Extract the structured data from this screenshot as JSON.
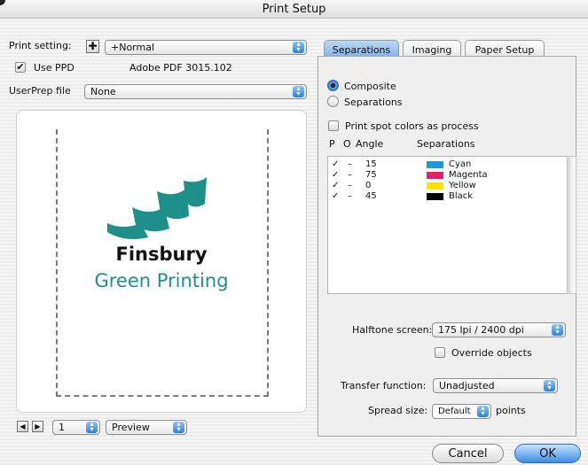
{
  "window": {
    "title": "Print Setup"
  },
  "left": {
    "print_setting_label": "Print setting:",
    "print_setting_value": "+Normal",
    "use_ppd_label": "Use PPD",
    "ppd_name": "Adobe PDF 3015.102",
    "userprep_label": "UserPrep file",
    "userprep_value": "None",
    "logo_line1": "Finsbury",
    "logo_line2": "Green Printing",
    "page_number": "1",
    "view_mode": "Preview"
  },
  "tabs": [
    {
      "label": "Separations"
    },
    {
      "label": "Imaging"
    },
    {
      "label": "Paper Setup"
    }
  ],
  "separations": {
    "composite_label": "Composite",
    "separations_label": "Separations",
    "spot_colors_label": "Print spot colors as process",
    "col_p": "P",
    "col_o": "O",
    "col_angle": "Angle",
    "col_separations": "Separations",
    "rows": [
      {
        "check": "✓",
        "dash": "–",
        "angle": "15",
        "name": "Cyan",
        "color": "#1a9ad6"
      },
      {
        "check": "✓",
        "dash": "–",
        "angle": "75",
        "name": "Magenta",
        "color": "#e4206a"
      },
      {
        "check": "✓",
        "dash": "–",
        "angle": "0",
        "name": "Yellow",
        "color": "#ffe600"
      },
      {
        "check": "✓",
        "dash": "–",
        "angle": "45",
        "name": "Black",
        "color": "#000000"
      }
    ],
    "halftone_label": "Halftone screen:",
    "halftone_value": "175 lpi / 2400 dpi",
    "override_label": "Override objects",
    "transfer_label": "Transfer function:",
    "transfer_value": "Unadjusted",
    "spread_label": "Spread size:",
    "spread_value": "Default",
    "spread_unit": "points"
  },
  "buttons": {
    "cancel": "Cancel",
    "ok": "OK"
  },
  "colors": {
    "logo_teal": "#1f8f8a",
    "accent_blue": "#3b8de4"
  }
}
